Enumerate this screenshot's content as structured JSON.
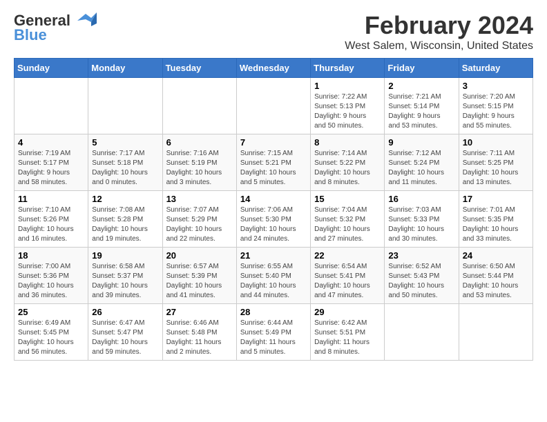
{
  "header": {
    "logo_line1": "General",
    "logo_line2": "Blue",
    "month": "February 2024",
    "location": "West Salem, Wisconsin, United States"
  },
  "days_of_week": [
    "Sunday",
    "Monday",
    "Tuesday",
    "Wednesday",
    "Thursday",
    "Friday",
    "Saturday"
  ],
  "weeks": [
    [
      {
        "day": "",
        "info": ""
      },
      {
        "day": "",
        "info": ""
      },
      {
        "day": "",
        "info": ""
      },
      {
        "day": "",
        "info": ""
      },
      {
        "day": "1",
        "info": "Sunrise: 7:22 AM\nSunset: 5:13 PM\nDaylight: 9 hours\nand 50 minutes."
      },
      {
        "day": "2",
        "info": "Sunrise: 7:21 AM\nSunset: 5:14 PM\nDaylight: 9 hours\nand 53 minutes."
      },
      {
        "day": "3",
        "info": "Sunrise: 7:20 AM\nSunset: 5:15 PM\nDaylight: 9 hours\nand 55 minutes."
      }
    ],
    [
      {
        "day": "4",
        "info": "Sunrise: 7:19 AM\nSunset: 5:17 PM\nDaylight: 9 hours\nand 58 minutes."
      },
      {
        "day": "5",
        "info": "Sunrise: 7:17 AM\nSunset: 5:18 PM\nDaylight: 10 hours\nand 0 minutes."
      },
      {
        "day": "6",
        "info": "Sunrise: 7:16 AM\nSunset: 5:19 PM\nDaylight: 10 hours\nand 3 minutes."
      },
      {
        "day": "7",
        "info": "Sunrise: 7:15 AM\nSunset: 5:21 PM\nDaylight: 10 hours\nand 5 minutes."
      },
      {
        "day": "8",
        "info": "Sunrise: 7:14 AM\nSunset: 5:22 PM\nDaylight: 10 hours\nand 8 minutes."
      },
      {
        "day": "9",
        "info": "Sunrise: 7:12 AM\nSunset: 5:24 PM\nDaylight: 10 hours\nand 11 minutes."
      },
      {
        "day": "10",
        "info": "Sunrise: 7:11 AM\nSunset: 5:25 PM\nDaylight: 10 hours\nand 13 minutes."
      }
    ],
    [
      {
        "day": "11",
        "info": "Sunrise: 7:10 AM\nSunset: 5:26 PM\nDaylight: 10 hours\nand 16 minutes."
      },
      {
        "day": "12",
        "info": "Sunrise: 7:08 AM\nSunset: 5:28 PM\nDaylight: 10 hours\nand 19 minutes."
      },
      {
        "day": "13",
        "info": "Sunrise: 7:07 AM\nSunset: 5:29 PM\nDaylight: 10 hours\nand 22 minutes."
      },
      {
        "day": "14",
        "info": "Sunrise: 7:06 AM\nSunset: 5:30 PM\nDaylight: 10 hours\nand 24 minutes."
      },
      {
        "day": "15",
        "info": "Sunrise: 7:04 AM\nSunset: 5:32 PM\nDaylight: 10 hours\nand 27 minutes."
      },
      {
        "day": "16",
        "info": "Sunrise: 7:03 AM\nSunset: 5:33 PM\nDaylight: 10 hours\nand 30 minutes."
      },
      {
        "day": "17",
        "info": "Sunrise: 7:01 AM\nSunset: 5:35 PM\nDaylight: 10 hours\nand 33 minutes."
      }
    ],
    [
      {
        "day": "18",
        "info": "Sunrise: 7:00 AM\nSunset: 5:36 PM\nDaylight: 10 hours\nand 36 minutes."
      },
      {
        "day": "19",
        "info": "Sunrise: 6:58 AM\nSunset: 5:37 PM\nDaylight: 10 hours\nand 39 minutes."
      },
      {
        "day": "20",
        "info": "Sunrise: 6:57 AM\nSunset: 5:39 PM\nDaylight: 10 hours\nand 41 minutes."
      },
      {
        "day": "21",
        "info": "Sunrise: 6:55 AM\nSunset: 5:40 PM\nDaylight: 10 hours\nand 44 minutes."
      },
      {
        "day": "22",
        "info": "Sunrise: 6:54 AM\nSunset: 5:41 PM\nDaylight: 10 hours\nand 47 minutes."
      },
      {
        "day": "23",
        "info": "Sunrise: 6:52 AM\nSunset: 5:43 PM\nDaylight: 10 hours\nand 50 minutes."
      },
      {
        "day": "24",
        "info": "Sunrise: 6:50 AM\nSunset: 5:44 PM\nDaylight: 10 hours\nand 53 minutes."
      }
    ],
    [
      {
        "day": "25",
        "info": "Sunrise: 6:49 AM\nSunset: 5:45 PM\nDaylight: 10 hours\nand 56 minutes."
      },
      {
        "day": "26",
        "info": "Sunrise: 6:47 AM\nSunset: 5:47 PM\nDaylight: 10 hours\nand 59 minutes."
      },
      {
        "day": "27",
        "info": "Sunrise: 6:46 AM\nSunset: 5:48 PM\nDaylight: 11 hours\nand 2 minutes."
      },
      {
        "day": "28",
        "info": "Sunrise: 6:44 AM\nSunset: 5:49 PM\nDaylight: 11 hours\nand 5 minutes."
      },
      {
        "day": "29",
        "info": "Sunrise: 6:42 AM\nSunset: 5:51 PM\nDaylight: 11 hours\nand 8 minutes."
      },
      {
        "day": "",
        "info": ""
      },
      {
        "day": "",
        "info": ""
      }
    ]
  ]
}
